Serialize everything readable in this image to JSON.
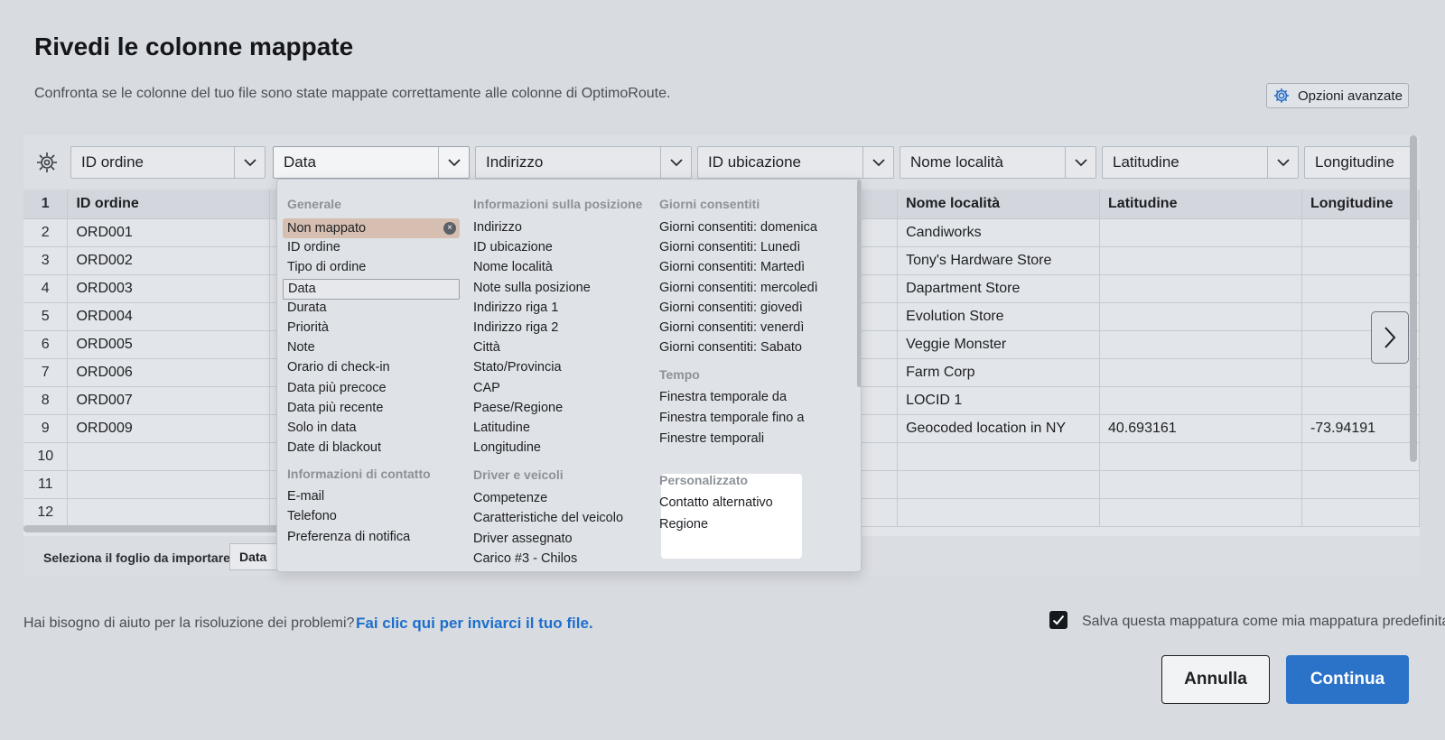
{
  "header": {
    "title": "Rivedi le colonne mappate",
    "subtitle": "Confronta se le colonne del tuo file sono state mappate correttamente alle colonne di OptimoRoute.",
    "advanced_label": "Opzioni avanzate"
  },
  "mapping": {
    "columns": [
      "ID ordine",
      "Data",
      "Indirizzo",
      "ID ubicazione",
      "Nome località",
      "Latitudine",
      "Longitudine"
    ]
  },
  "table": {
    "headers": [
      "ID ordine",
      "",
      "",
      "",
      "Nome località",
      "Latitudine",
      "Longitudine"
    ],
    "rows": [
      {
        "n": "2",
        "id": "ORD001",
        "place": "Candiworks",
        "lat": "",
        "lng": ""
      },
      {
        "n": "3",
        "id": "ORD002",
        "place": "Tony's Hardware Store",
        "lat": "",
        "lng": ""
      },
      {
        "n": "4",
        "id": "ORD003",
        "place": "Dapartment Store",
        "lat": "",
        "lng": ""
      },
      {
        "n": "5",
        "id": "ORD004",
        "place": "Evolution Store",
        "lat": "",
        "lng": ""
      },
      {
        "n": "6",
        "id": "ORD005",
        "place": "Veggie Monster",
        "lat": "",
        "lng": ""
      },
      {
        "n": "7",
        "id": "ORD006",
        "place": "Farm Corp",
        "lat": "",
        "lng": ""
      },
      {
        "n": "8",
        "id": "ORD007",
        "place": "LOCID 1",
        "lat": "",
        "lng": ""
      },
      {
        "n": "9",
        "id": "ORD009",
        "place": "Geocoded location in NY",
        "lat": "40.693161",
        "lng": "-73.94191"
      },
      {
        "n": "10",
        "id": "",
        "place": "",
        "lat": "",
        "lng": ""
      },
      {
        "n": "11",
        "id": "",
        "place": "",
        "lat": "",
        "lng": ""
      },
      {
        "n": "12",
        "id": "",
        "place": "",
        "lat": "",
        "lng": ""
      }
    ],
    "header_row_number": "1"
  },
  "dropdown": {
    "general": {
      "heading": "Generale",
      "items": [
        "Non mappato",
        "ID ordine",
        "Tipo di ordine",
        "Data",
        "Durata",
        "Priorità",
        "Note",
        "Orario di check-in",
        "Data più precoce",
        "Data più recente",
        "Solo in data",
        "Date di blackout"
      ]
    },
    "contact": {
      "heading": "Informazioni di contatto",
      "items": [
        "E-mail",
        "Telefono",
        "Preferenza di notifica"
      ]
    },
    "location": {
      "heading": "Informazioni sulla posizione",
      "items": [
        "Indirizzo",
        "ID ubicazione",
        "Nome località",
        "Note sulla posizione",
        "Indirizzo riga 1",
        "Indirizzo riga 2",
        "Città",
        "Stato/Provincia",
        "CAP",
        "Paese/Regione",
        "Latitudine",
        "Longitudine"
      ]
    },
    "drivers": {
      "heading": "Driver e veicoli",
      "items": [
        "Competenze",
        "Caratteristiche del veicolo",
        "Driver assegnato",
        "Carico #3 - Chilos"
      ]
    },
    "days": {
      "heading": "Giorni consentiti",
      "items": [
        "Giorni consentiti: domenica",
        "Giorni consentiti: Lunedì",
        "Giorni consentiti: Martedì",
        "Giorni consentiti: mercoledì",
        "Giorni consentiti: giovedì",
        "Giorni consentiti: venerdì",
        "Giorni consentiti: Sabato"
      ]
    },
    "time": {
      "heading": "Tempo",
      "items": [
        "Finestra temporale da",
        "Finestra temporale fino a",
        "Finestre temporali"
      ]
    },
    "custom": {
      "heading": "Personalizzato",
      "items": [
        "Contatto alternativo",
        "Regione"
      ]
    }
  },
  "sheet": {
    "label": "Seleziona il foglio da importare:",
    "tab": "Data"
  },
  "footer": {
    "help_text": "Hai bisogno di aiuto per la risoluzione dei problemi?",
    "help_link": "Fai clic qui per inviarci il tuo file.",
    "save_label": "Salva questa mappatura come mia mappatura predefinita",
    "cancel": "Annulla",
    "continue": "Continua"
  },
  "colors": {
    "accent": "#2b72c9",
    "link": "#1e6fcc",
    "unmapped_highlight": "#d6bfb0"
  }
}
